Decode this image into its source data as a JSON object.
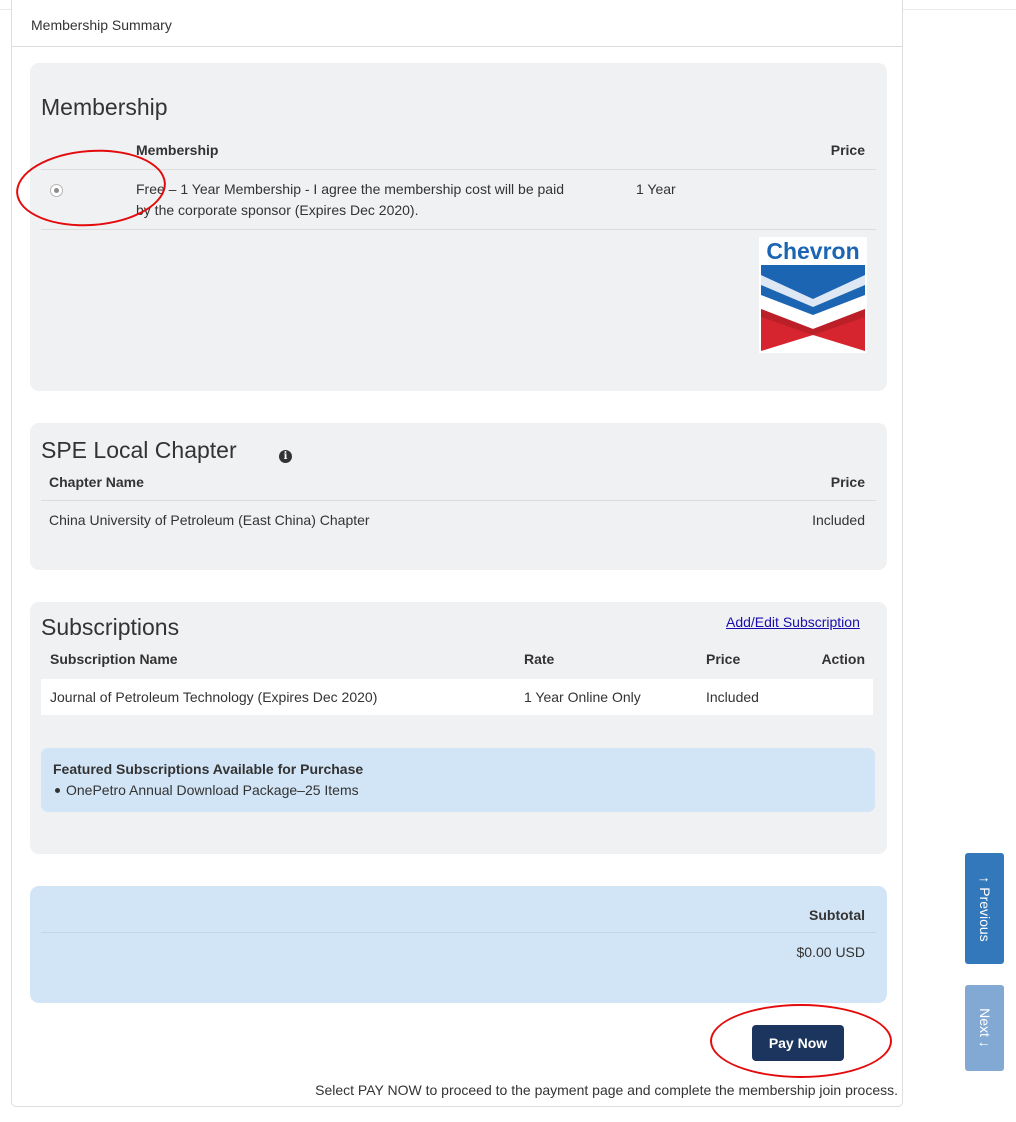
{
  "header": {
    "title": "Membership Summary"
  },
  "membership": {
    "title": "Membership",
    "col_membership": "Membership",
    "col_price": "Price",
    "option_line1": "Free – 1 Year Membership - I agree the membership cost will be paid",
    "option_line2": "by the corporate sponsor (Expires Dec 2020).",
    "option_term": "1 Year",
    "option_selected": true,
    "sponsor_logo": "Chevron"
  },
  "chapter": {
    "title": "SPE Local Chapter",
    "info_icon": "info-circle-icon",
    "col_name": "Chapter Name",
    "col_price": "Price",
    "name": "China University of Petroleum (East China) Chapter",
    "price": "Included"
  },
  "subscriptions": {
    "title": "Subscriptions",
    "add_edit_link": "Add/Edit Subscription",
    "col_name": "Subscription Name",
    "col_rate": "Rate",
    "col_price": "Price",
    "col_action": "Action",
    "rows": [
      {
        "name": "Journal of Petroleum Technology (Expires Dec 2020)",
        "rate": "1 Year Online Only",
        "price": "Included",
        "action": ""
      }
    ],
    "featured_title": "Featured Subscriptions Available for Purchase",
    "featured_items": [
      "OnePetro Annual Download Package–25 Items"
    ]
  },
  "totals": {
    "subtotal_label": "Subtotal",
    "subtotal_value": "$0.00 USD"
  },
  "actions": {
    "pay_now": "Pay Now",
    "pay_note": "Select PAY NOW to proceed to the payment page and complete the membership join process."
  },
  "side_nav": {
    "previous_label": "Previous",
    "next_label": "Next",
    "previous_icon": "arrow-up-icon",
    "next_icon": "arrow-down-icon"
  },
  "colors": {
    "card_bg": "#f0f1f3",
    "highlight_bg": "#d2e5f6",
    "pay_button": "#1b355f",
    "previous_button": "#3278bb",
    "next_button": "#82a9d3",
    "annotation": "#e30b0b",
    "chevron_blue": "#1c65b3",
    "chevron_red": "#d7252f"
  }
}
